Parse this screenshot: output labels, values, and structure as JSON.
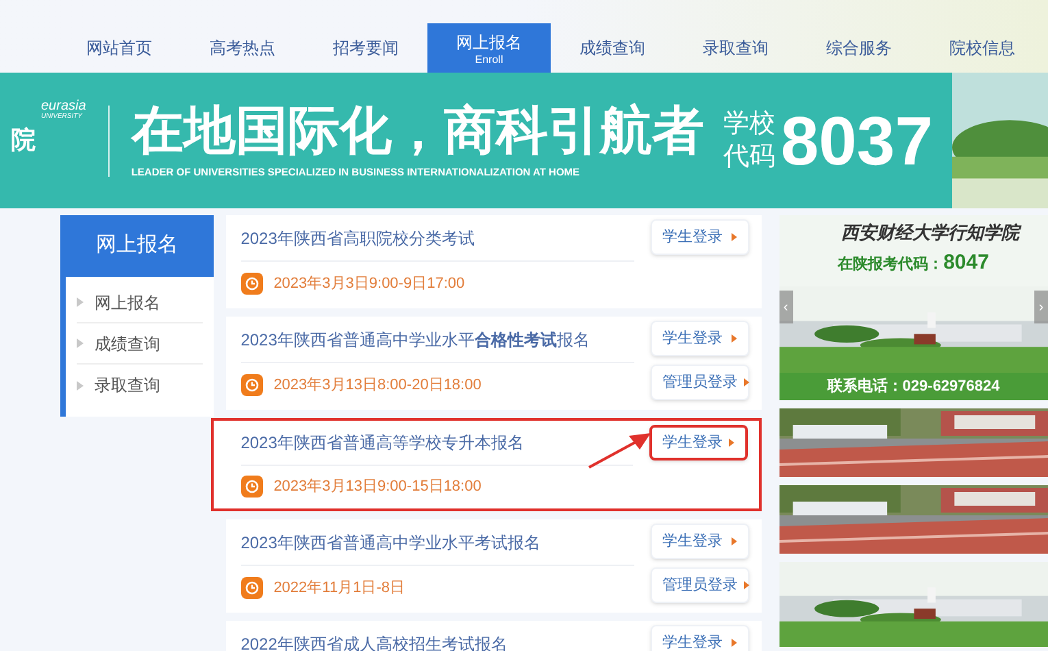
{
  "nav": [
    {
      "label": "网站首页",
      "selected": false
    },
    {
      "label": "高考热点",
      "selected": false
    },
    {
      "label": "招考要闻",
      "selected": false
    },
    {
      "label": "网上报名",
      "sub": "Enroll",
      "selected": true
    },
    {
      "label": "成绩查询",
      "selected": false
    },
    {
      "label": "录取查询",
      "selected": false
    },
    {
      "label": "综合服务",
      "selected": false
    },
    {
      "label": "院校信息",
      "selected": false
    }
  ],
  "banner": {
    "school_fragment": "院",
    "school_en_1": "eurasia",
    "school_en_2": "UNIVERSITY",
    "slogan": "在地国际化，商科引航者",
    "slogan_en": "LEADER OF UNIVERSITIES SPECIALIZED IN BUSINESS INTERNATIONALIZATION AT HOME",
    "code_label_1": "学校",
    "code_label_2": "代码",
    "code": "8037"
  },
  "sidebar": {
    "title": "网上报名",
    "items": [
      {
        "label": "网上报名"
      },
      {
        "label": "成绩查询"
      },
      {
        "label": "录取查询"
      }
    ]
  },
  "exams": [
    {
      "title": "2023年陕西省高职院校分类考试",
      "time": "2023年3月3日9:00-9日17:00",
      "highlighted": false,
      "buttons": [
        {
          "label": "学生登录",
          "highlighted": false
        }
      ]
    },
    {
      "title": "2023年陕西省普通高中学业水平**合格性考试**报名",
      "time": "2023年3月13日8:00-20日18:00",
      "highlighted": false,
      "buttons": [
        {
          "label": "学生登录",
          "highlighted": false
        },
        {
          "label": "管理员登录",
          "highlighted": false
        }
      ]
    },
    {
      "title": "2023年陕西省普通高等学校专升本报名",
      "time": "2023年3月13日9:00-15日18:00",
      "highlighted": true,
      "buttons": [
        {
          "label": "学生登录",
          "highlighted": true
        }
      ]
    },
    {
      "title": "2023年陕西省普通高中学业水平考试报名",
      "time": "2022年11月1日-8日",
      "highlighted": false,
      "buttons": [
        {
          "label": "学生登录",
          "highlighted": false
        },
        {
          "label": "管理员登录",
          "highlighted": false
        }
      ]
    },
    {
      "title": "2022年陕西省成人高校招生考试报名",
      "highlighted": false,
      "buttons": [
        {
          "label": "学生登录",
          "highlighted": false
        }
      ]
    }
  ],
  "ad": {
    "college": "西安财经大学行知学院",
    "code_line": "在陕报考代码：",
    "code": "8047",
    "phone": "联系电话：029-62976824",
    "prev": "‹",
    "next": "›"
  }
}
